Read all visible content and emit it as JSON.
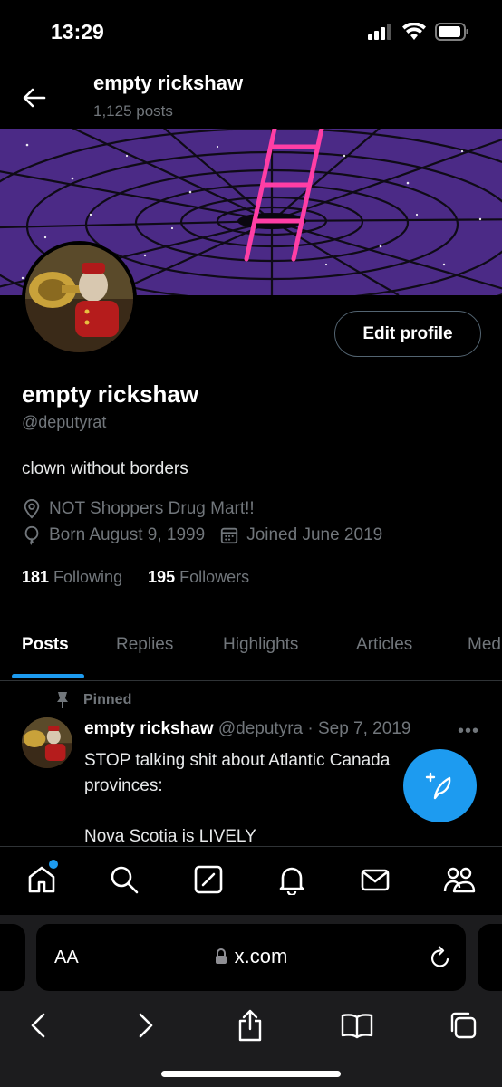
{
  "status": {
    "time": "13:29"
  },
  "header": {
    "name": "empty rickshaw",
    "posts": "1,125 posts"
  },
  "profile": {
    "edit_label": "Edit profile",
    "display_name": "empty rickshaw",
    "handle": "@deputyrat",
    "bio": "clown without borders",
    "location": "NOT Shoppers Drug Mart!!",
    "born": "Born August 9, 1999",
    "joined": "Joined June 2019",
    "following_count": "181",
    "following_label": "Following",
    "followers_count": "195",
    "followers_label": "Followers"
  },
  "tabs": [
    "Posts",
    "Replies",
    "Highlights",
    "Articles",
    "Media"
  ],
  "post": {
    "pinned_label": "Pinned",
    "name": "empty rickshaw",
    "handle_date": "@deputyra · Sep 7, 2019",
    "line1": "STOP talking shit about Atlantic Canada",
    "line2": "provinces:",
    "line3": "Nova Scotia is LIVELY"
  },
  "safari": {
    "aa": "AA",
    "url": "x.com"
  },
  "colors": {
    "accent": "#1d9bf0",
    "banner": "#4b2a86",
    "ladder": "#ff3ea5"
  },
  "icons": [
    "home-icon",
    "search-icon",
    "grok-icon",
    "bell-icon",
    "mail-icon",
    "communities-icon",
    "compose-icon"
  ]
}
